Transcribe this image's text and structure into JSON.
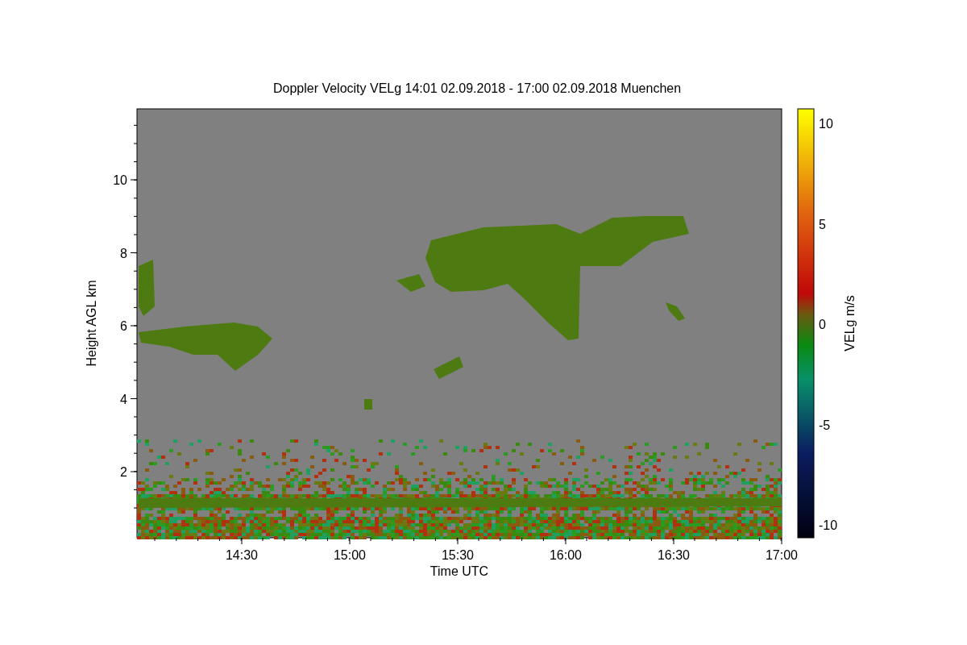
{
  "title": "Doppler Velocity VELg   14:01 02.09.2018 - 17:00 02.09.2018 Muenchen",
  "x_axis": {
    "label": "Time UTC",
    "ticks": [
      "14:30",
      "15:00",
      "15:30",
      "16:00",
      "16:30",
      "17:00"
    ]
  },
  "y_axis": {
    "label": "Height AGL km",
    "ticks": [
      "10",
      "8",
      "6",
      "4",
      "2"
    ]
  },
  "colorbar": {
    "label": "VELg m/s",
    "ticks": [
      "10",
      "5",
      "0",
      "-5",
      "-10"
    ]
  }
}
